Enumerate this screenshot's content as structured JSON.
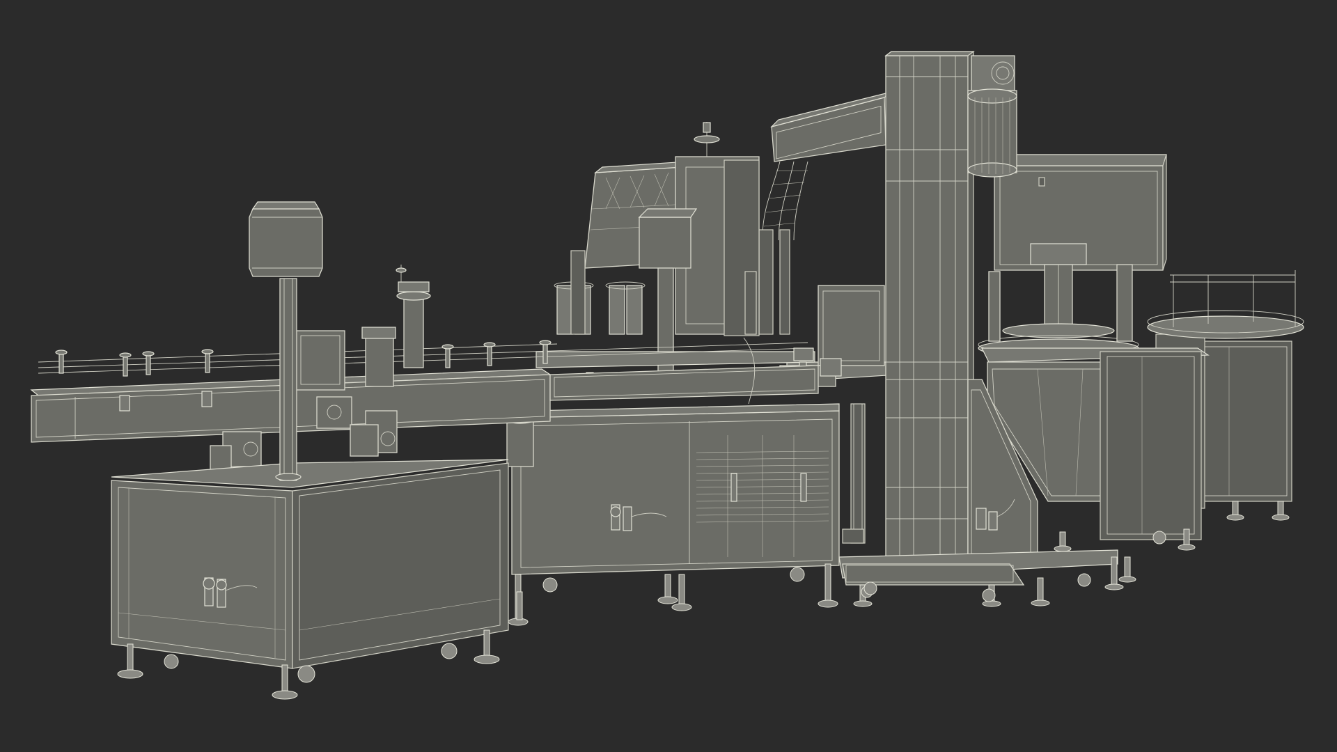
{
  "scene": {
    "background_color": "#2b2b2b",
    "mesh_fill_color": "#6b6c66",
    "wire_color": "#d8d8cc"
  }
}
